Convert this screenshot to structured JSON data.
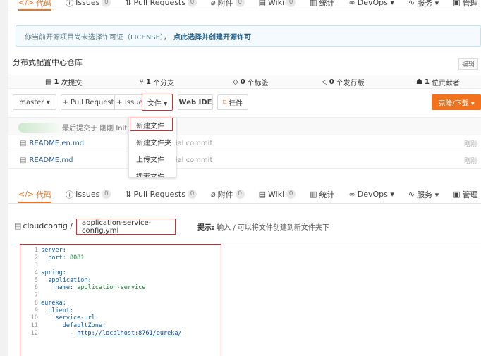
{
  "nav_top": [
    {
      "icon": "</>",
      "label": "代码",
      "active": true
    },
    {
      "icon": "ⓘ",
      "label": "Issues",
      "count": "0"
    },
    {
      "icon": "⇅",
      "label": "Pull Requests",
      "count": "0"
    },
    {
      "icon": "⌀",
      "label": "附件",
      "count": "0"
    },
    {
      "icon": "▤",
      "label": "Wiki",
      "count": "0"
    },
    {
      "icon": "▥",
      "label": "统计"
    },
    {
      "icon": "∞",
      "label": "DevOps ▾"
    },
    {
      "icon": "∿",
      "label": "服务 ▾"
    },
    {
      "icon": "▣",
      "label": "管理"
    }
  ],
  "notice": {
    "text": "你当前开源项目尚未选择许可证（LICENSE），",
    "link": "点此选择并创建开源许可"
  },
  "repo": {
    "title": "分布式配置中心仓库",
    "edit": "编辑"
  },
  "stats": {
    "commits_num": "1",
    "commits_label": "次提交",
    "branches_num": "1",
    "branches_label": "个分支",
    "tags_num": "0",
    "tags_label": "个标签",
    "releases_num": "0",
    "releases_label": "个发行版",
    "contributors_num": "1",
    "contributors_label": "位贡献者"
  },
  "toolbar": {
    "branch": "master ▾",
    "pull_request": "+ Pull Request",
    "issue": "+ Issue",
    "file": "文件 ▾",
    "web_ide": "Web IDE",
    "mount": "挂件",
    "clone": "克隆/下载 ▾"
  },
  "commit": {
    "text": "最后提交于 刚刚 Init"
  },
  "files": [
    {
      "name": "README.en.md",
      "msg": "itial commit",
      "time": "刚刚"
    },
    {
      "name": "README.md",
      "msg": "itial commit",
      "time": "刚刚"
    }
  ],
  "dropdown": {
    "items": [
      "新建文件",
      "新建文件夹",
      "上传文件",
      "搜索文件"
    ]
  },
  "nav_second": [
    {
      "icon": "</>",
      "label": "代码",
      "active": true
    },
    {
      "icon": "ⓘ",
      "label": "Issues",
      "count": "0"
    },
    {
      "icon": "⇅",
      "label": "Pull Requests",
      "count": "0"
    },
    {
      "icon": "⌀",
      "label": "附件",
      "count": "0"
    },
    {
      "icon": "▤",
      "label": "Wiki",
      "count": "0"
    },
    {
      "icon": "▥",
      "label": "统计"
    },
    {
      "icon": "∞",
      "label": "DevOps ▾"
    },
    {
      "icon": "∿",
      "label": "服务 ▾"
    },
    {
      "icon": "▣",
      "label": "管理"
    }
  ],
  "path": {
    "folder": "cloudconfig /",
    "filename": "application-service-config.yml",
    "hint_bold": "提示:",
    "hint": "输入 / 可以将文件创建到新文件夹下"
  },
  "code_lines": [
    "server:",
    "  port: 8081",
    "",
    "spring:",
    "  application:",
    "    name: application-service",
    "",
    "eureka:",
    "  client:",
    "    service-url:",
    "      defaultZone:",
    "        - http://localhost:8761/eureka/"
  ],
  "line_numbers": [
    "1",
    "2",
    "3",
    "4",
    "5",
    "6",
    "7",
    "8",
    "9",
    "10",
    "11",
    "12"
  ]
}
